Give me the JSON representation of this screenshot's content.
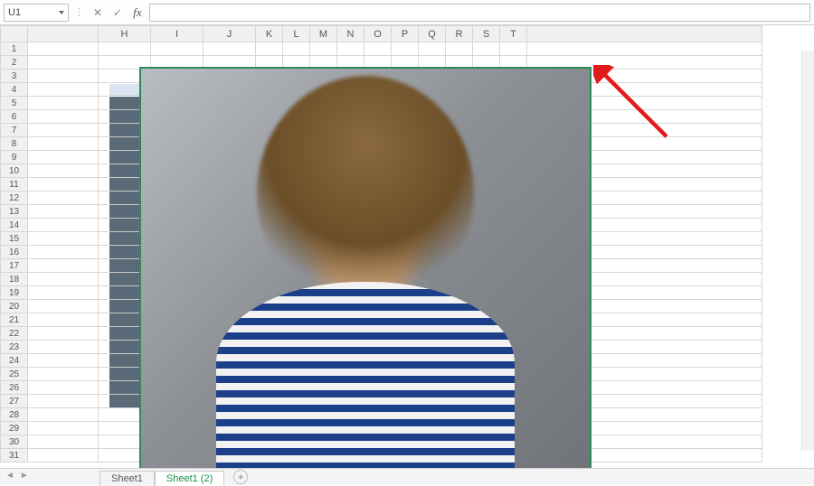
{
  "formula_bar": {
    "name_box_value": "U1",
    "cancel_glyph": "✕",
    "confirm_glyph": "✓",
    "fx_label": "fx",
    "formula_value": ""
  },
  "columns": [
    "H",
    "I",
    "J",
    "K",
    "L",
    "M",
    "N",
    "O",
    "P",
    "Q",
    "R",
    "S",
    "T"
  ],
  "wide_columns": [
    "H",
    "I",
    "J"
  ],
  "rows": [
    1,
    2,
    3,
    4,
    5,
    6,
    7,
    8,
    9,
    10,
    11,
    12,
    13,
    14,
    15,
    16,
    17,
    18,
    19,
    20,
    21,
    22,
    23,
    24,
    25,
    26,
    27,
    28,
    29,
    30,
    31
  ],
  "embedded_table": {
    "cols": 2,
    "rows": 23
  },
  "sheet_tabs": {
    "tabs": [
      {
        "label": "Sheet1",
        "active": false
      },
      {
        "label": "Sheet1 (2)",
        "active": true
      }
    ],
    "add_glyph": "+"
  },
  "annotation": {
    "type": "arrow",
    "color": "#e01b1b"
  }
}
